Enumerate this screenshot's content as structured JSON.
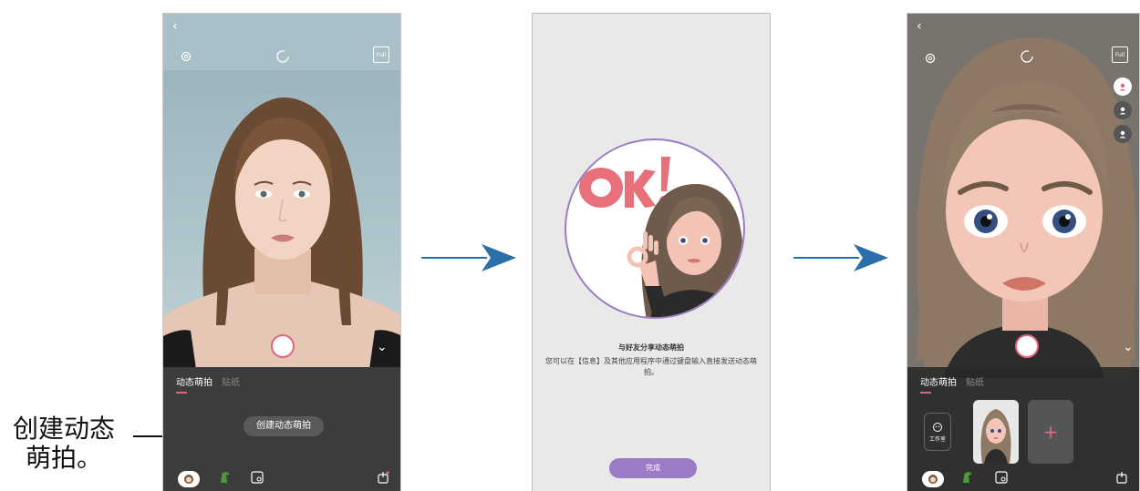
{
  "annotation": {
    "line1": "创建动态",
    "line2": "萌拍。"
  },
  "screen1": {
    "back_glyph": "‹",
    "full_label": "Full",
    "tabs": [
      "动态萌拍",
      "贴纸"
    ],
    "create_button_label": "创建动态萌拍"
  },
  "screen2": {
    "sticker_text": "OK!",
    "title": "与好友分享动态萌拍",
    "description": "您可以在【信息】及其他应用程序中通过键盘输入直接发送动态萌拍。",
    "done_label": "完成"
  },
  "screen3": {
    "back_glyph": "‹",
    "full_label": "Full",
    "tabs": [
      "动态萌拍",
      "贴纸"
    ],
    "studio_label": "工作室",
    "add_glyph": "+"
  },
  "colors": {
    "accent": "#e0667e",
    "arrow": "#2a6fa8",
    "done_button": "#9a7cc6"
  },
  "icons": [
    "back-icon",
    "gear-icon",
    "timer-icon",
    "full-icon",
    "shutter-button",
    "chevron-down-icon",
    "avatar-icon",
    "dinosaur-icon",
    "sticker-icon",
    "share-icon",
    "person-icon",
    "face-icon"
  ]
}
